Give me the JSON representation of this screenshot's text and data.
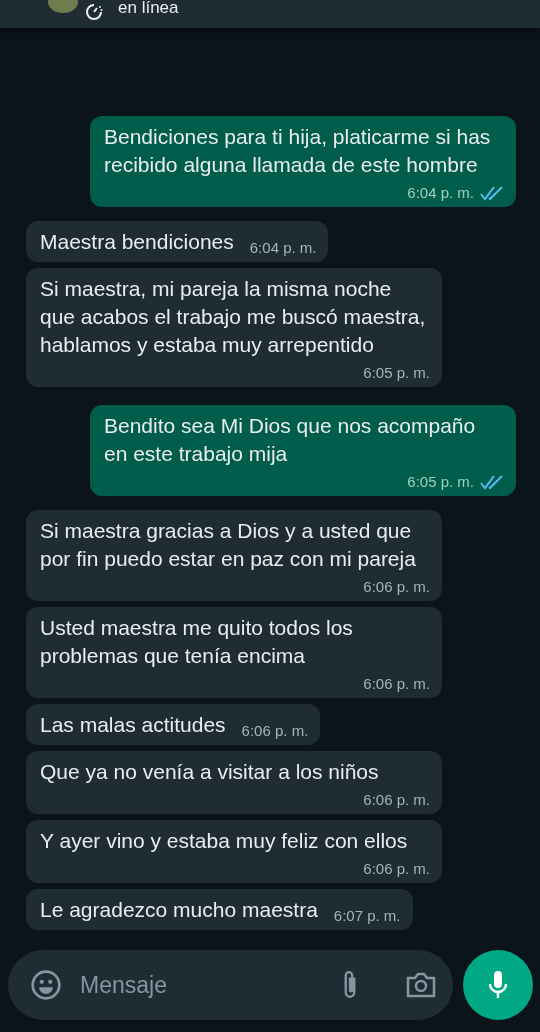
{
  "header": {
    "status": "en línea"
  },
  "messages": [
    {
      "kind": "out",
      "text": "Bendiciones para ti hija, platicarme si has recibido alguna llamada de este hombre",
      "time": "6:04 p. m.",
      "read": true
    },
    {
      "kind": "in",
      "text": "Maestra bendiciones",
      "time": "6:04 p. m."
    },
    {
      "kind": "in",
      "text": "Si maestra, mi pareja la misma noche que acabos el trabajo me buscó maestra, hablamos y estaba muy arrepentido",
      "time": "6:05 p. m."
    },
    {
      "kind": "out",
      "text": "Bendito sea Mi Dios que nos acompaño en este trabajo mija",
      "time": "6:05 p. m.",
      "read": true
    },
    {
      "kind": "in",
      "text": "Si maestra gracias a Dios y a usted que por fin puedo estar en paz con mi pareja",
      "time": "6:06 p. m."
    },
    {
      "kind": "in",
      "text": "Usted maestra me quito todos los problemas que tenía encima",
      "time": "6:06 p. m."
    },
    {
      "kind": "in",
      "text": "Las malas actitudes",
      "time": "6:06 p. m."
    },
    {
      "kind": "in",
      "text": "Que ya no venía a visitar a los niños",
      "time": "6:06 p. m."
    },
    {
      "kind": "in",
      "text": "Y ayer vino y estaba muy feliz con ellos",
      "time": "6:06 p. m."
    },
    {
      "kind": "in",
      "text": "Le agradezco mucho maestra",
      "time": "6:07 p. m."
    }
  ],
  "composer": {
    "placeholder": "Mensaje"
  }
}
